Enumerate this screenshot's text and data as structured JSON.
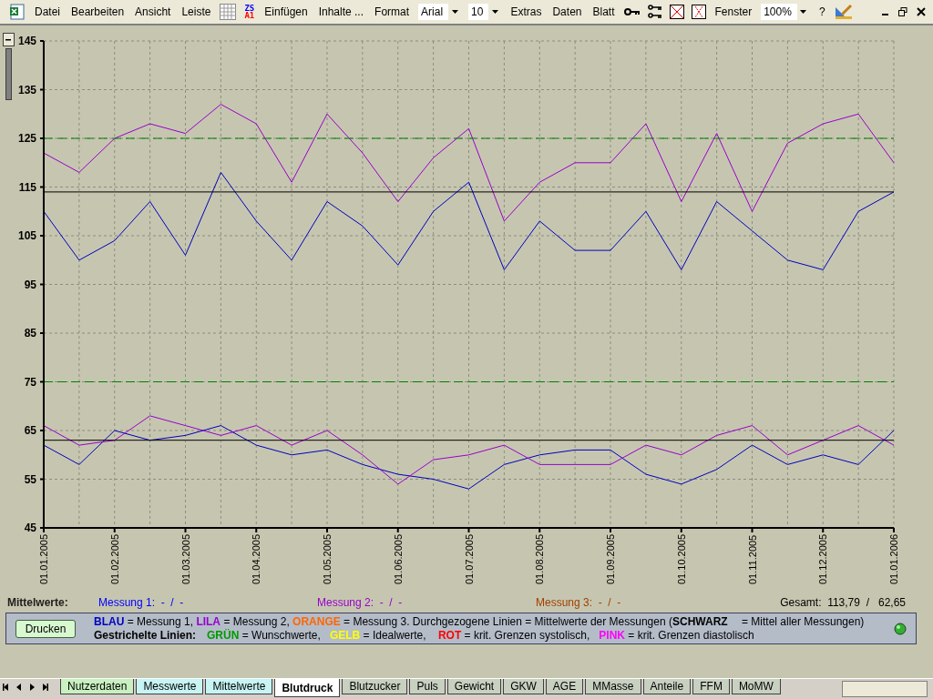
{
  "menu_bar": {
    "items": [
      {
        "kind": "app-icon"
      },
      {
        "kind": "menu",
        "label": "Datei"
      },
      {
        "kind": "menu",
        "label": "Bearbeiten"
      },
      {
        "kind": "menu",
        "label": "Ansicht"
      },
      {
        "kind": "menu",
        "label": "Leiste"
      },
      {
        "kind": "grid-icon"
      },
      {
        "kind": "zs-icon",
        "top": "ZS",
        "bottom": "A1"
      },
      {
        "kind": "menu",
        "label": "Einfügen"
      },
      {
        "kind": "menu",
        "label": "Inhalte ..."
      },
      {
        "kind": "menu",
        "label": "Format"
      },
      {
        "kind": "combo",
        "value": "Arial"
      },
      {
        "kind": "combo",
        "value": "10"
      },
      {
        "kind": "menu",
        "label": "Extras"
      },
      {
        "kind": "menu",
        "label": "Daten"
      },
      {
        "kind": "menu",
        "label": "Blatt"
      },
      {
        "kind": "key-icon"
      },
      {
        "kind": "keys-icon"
      },
      {
        "kind": "cross-icon"
      },
      {
        "kind": "dotted-cross-icon"
      },
      {
        "kind": "menu",
        "label": "Fenster"
      },
      {
        "kind": "combo",
        "value": "100%"
      },
      {
        "kind": "menu",
        "label": "?"
      },
      {
        "kind": "draw-icon"
      }
    ]
  },
  "chart_data": {
    "type": "line",
    "grid": true,
    "categories": [
      "01.01.2005",
      null,
      "01.02.2005",
      null,
      "01.03.2005",
      null,
      "01.04.2005",
      null,
      "01.05.2005",
      null,
      "01.06.2005",
      null,
      "01.07.2005",
      null,
      "01.08.2005",
      null,
      "01.09.2005",
      null,
      "01.10.2005",
      null,
      "01.11.2005",
      null,
      "01.12.2005",
      null,
      "01.01.2006"
    ],
    "ylim": [
      45,
      145
    ],
    "yticks": [
      45,
      55,
      65,
      75,
      85,
      95,
      105,
      115,
      125,
      135,
      145
    ],
    "series": [
      {
        "line_style": "solid",
        "color": "#0000c0",
        "values": [
          110,
          100,
          104,
          112,
          101,
          118,
          108,
          100,
          112,
          107,
          99,
          110,
          116,
          98,
          108,
          102,
          102,
          110,
          98,
          112,
          106,
          100,
          98,
          110,
          114
        ]
      },
      {
        "line_style": "solid",
        "color": "#9900cc",
        "values": [
          122,
          118,
          125,
          128,
          126,
          132,
          128,
          116,
          130,
          122,
          112,
          121,
          127,
          108,
          116,
          120,
          120,
          128,
          112,
          126,
          110,
          124,
          128,
          130,
          120
        ]
      },
      {
        "line_style": "solid",
        "color": "#0000c0",
        "values": [
          62,
          58,
          65,
          63,
          64,
          66,
          62,
          60,
          61,
          58,
          56,
          55,
          53,
          58,
          60,
          61,
          61,
          56,
          54,
          57,
          62,
          58,
          60,
          58,
          65
        ]
      },
      {
        "line_style": "solid",
        "color": "#9900cc",
        "values": [
          66,
          62,
          63,
          68,
          66,
          64,
          66,
          62,
          65,
          60,
          54,
          59,
          60,
          62,
          58,
          58,
          58,
          62,
          60,
          64,
          66,
          60,
          63,
          66,
          62
        ]
      },
      {
        "line_style": "solid",
        "color": "#000000",
        "values": [
          114,
          114,
          114,
          114,
          114,
          114,
          114,
          114,
          114,
          114,
          114,
          114,
          114,
          114,
          114,
          114,
          114,
          114,
          114,
          114,
          114,
          114,
          114,
          114,
          114
        ]
      },
      {
        "line_style": "solid",
        "color": "#000000",
        "values": [
          63,
          63,
          63,
          63,
          63,
          63,
          63,
          63,
          63,
          63,
          63,
          63,
          63,
          63,
          63,
          63,
          63,
          63,
          63,
          63,
          63,
          63,
          63,
          63,
          63
        ]
      },
      {
        "line_style": "dashed",
        "color": "#008000",
        "values": [
          125,
          125,
          125,
          125,
          125,
          125,
          125,
          125,
          125,
          125,
          125,
          125,
          125,
          125,
          125,
          125,
          125,
          125,
          125,
          125,
          125,
          125,
          125,
          125,
          125
        ]
      },
      {
        "line_style": "dashed",
        "color": "#008000",
        "values": [
          75,
          75,
          75,
          75,
          75,
          75,
          75,
          75,
          75,
          75,
          75,
          75,
          75,
          75,
          75,
          75,
          75,
          75,
          75,
          75,
          75,
          75,
          75,
          75,
          75
        ]
      }
    ]
  },
  "averages": {
    "label": "Mittelwerte:",
    "items": [
      {
        "text": "Messung 1:  -  /  -",
        "color": "#0000ff"
      },
      {
        "text": "Messung 2:  -  /  -",
        "color": "#9900cc"
      },
      {
        "text": "Messung 3:  -  /  -",
        "color": "#a04000"
      }
    ],
    "total": "Gesamt:  113,79  /   62,65"
  },
  "legend": {
    "button": "Drucken",
    "lines": [
      [
        {
          "text": "BLAU",
          "color": "#0000c0",
          "bold": true
        },
        {
          "text": " = Messung 1, "
        },
        {
          "text": "LILA",
          "color": "#9900cc",
          "bold": true
        },
        {
          "text": " = Messung 2, "
        },
        {
          "text": "ORANGE",
          "color": "#ff6600",
          "bold": true
        },
        {
          "text": " = Messung 3. Durchgezogene Linien = Mittelwerte der Messungen ("
        },
        {
          "text": "SCHWARZ",
          "bold": true
        },
        {
          "text": " = Mittel aller Messungen)"
        }
      ],
      [
        {
          "text": "Gestrichelte Linien:",
          "bold": true
        },
        {
          "text": "GRÜN",
          "color": "#009900",
          "bold": true
        },
        {
          "text": " = Wunschwerte,   "
        },
        {
          "text": "GELB",
          "color": "#ffff00",
          "bold": true
        },
        {
          "text": " = Idealwerte,    "
        },
        {
          "text": "ROT",
          "color": "#ff0000",
          "bold": true
        },
        {
          "text": " = krit. Grenzen systolisch,   "
        },
        {
          "text": "PINK",
          "color": "#ff00ff",
          "bold": true
        },
        {
          "text": " = krit. Grenzen diastolisch"
        }
      ]
    ]
  },
  "sheet_tabs": [
    {
      "label": "Nutzerdaten",
      "selected": false,
      "color": "#c8f0c0"
    },
    {
      "label": "Messwerte",
      "selected": false,
      "color": "#c8f4f4"
    },
    {
      "label": "Mittelwerte",
      "selected": false,
      "color": "#c8f4f4"
    },
    {
      "label": "Blutdruck",
      "selected": true,
      "color": "#ffffff"
    },
    {
      "label": "Blutzucker",
      "selected": false,
      "color": "#c8d0c0"
    },
    {
      "label": "Puls",
      "selected": false,
      "color": "#c8d0c0"
    },
    {
      "label": "Gewicht",
      "selected": false,
      "color": "#c8d0c0"
    },
    {
      "label": "GKW",
      "selected": false,
      "color": "#c8d0c0"
    },
    {
      "label": "AGE",
      "selected": false,
      "color": "#c8d0c0"
    },
    {
      "label": "MMasse",
      "selected": false,
      "color": "#c8d0c0"
    },
    {
      "label": "Anteile",
      "selected": false,
      "color": "#c8d0c0"
    },
    {
      "label": "FFM",
      "selected": false,
      "color": "#c8d0c0"
    },
    {
      "label": "MoMW",
      "selected": false,
      "color": "#c8d0c0"
    }
  ]
}
